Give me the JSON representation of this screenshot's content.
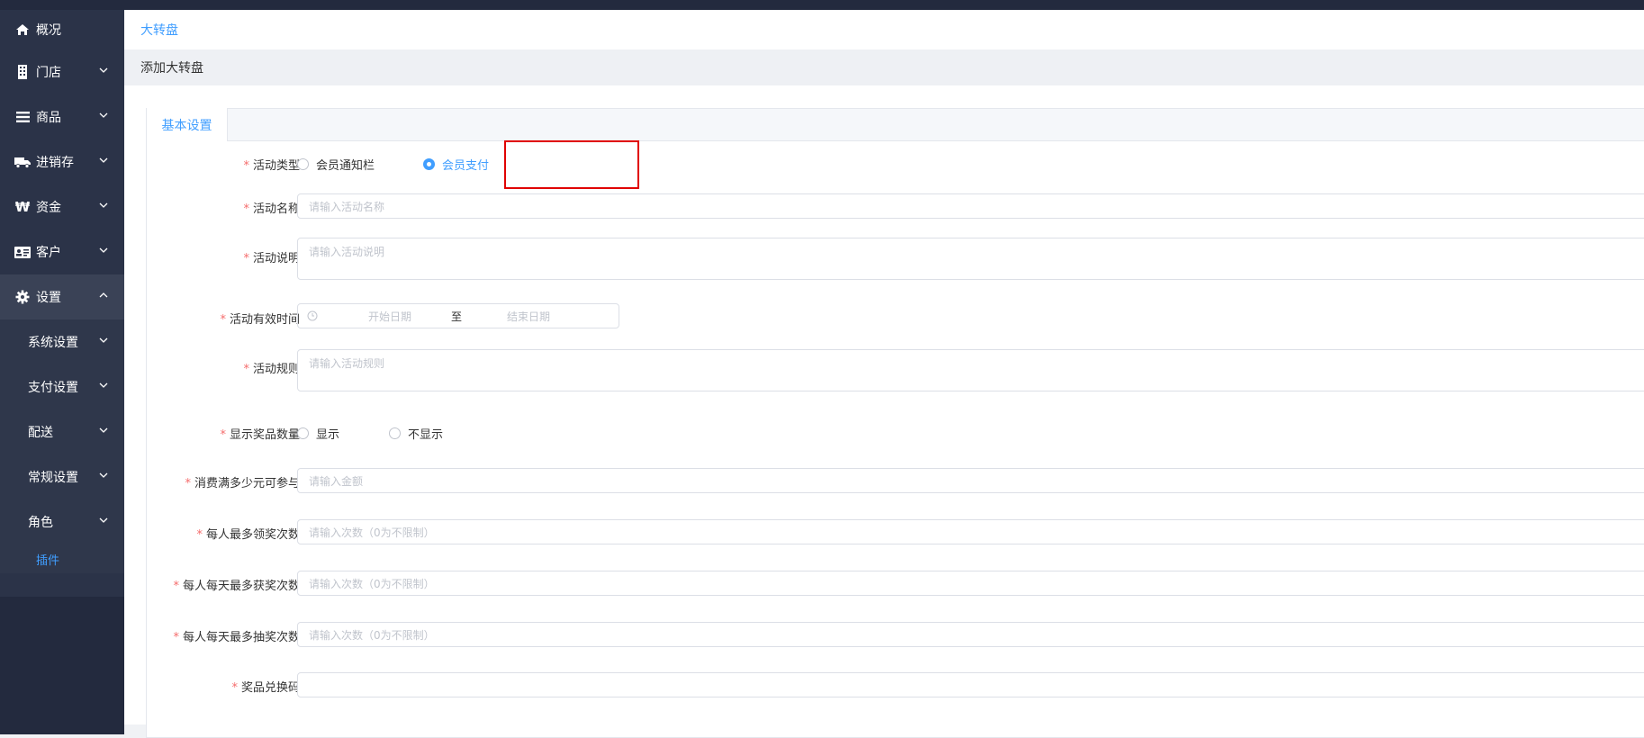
{
  "sidebar": {
    "items": [
      {
        "label": "概况",
        "icon": "home-icon"
      },
      {
        "label": "门店",
        "icon": "building-icon"
      },
      {
        "label": "商品",
        "icon": "list-icon"
      },
      {
        "label": "进销存",
        "icon": "truck-icon"
      },
      {
        "label": "资金",
        "icon": "won-icon"
      },
      {
        "label": "客户",
        "icon": "id-card-icon"
      },
      {
        "label": "设置",
        "icon": "gear-icon"
      }
    ],
    "sub_items": [
      {
        "label": "系统设置"
      },
      {
        "label": "支付设置"
      },
      {
        "label": "配送"
      },
      {
        "label": "常规设置"
      },
      {
        "label": "角色"
      }
    ],
    "leaf": "插件"
  },
  "breadcrumb": "大转盘",
  "subtitle": "添加大转盘",
  "tab": "基本设置",
  "form": {
    "activity_type": {
      "label": "活动类型",
      "options": [
        "会员通知栏",
        "会员支付"
      ],
      "selected": "会员支付"
    },
    "activity_name": {
      "label": "活动名称",
      "placeholder": "请输入活动名称"
    },
    "activity_desc": {
      "label": "活动说明",
      "placeholder": "请输入活动说明"
    },
    "valid_time": {
      "label": "活动有效时间",
      "start_placeholder": "开始日期",
      "separator": "至",
      "end_placeholder": "结束日期"
    },
    "activity_rules": {
      "label": "活动规则",
      "placeholder": "请输入活动规则"
    },
    "show_prize_count": {
      "label": "显示奖品数量",
      "options": [
        "显示",
        "不显示"
      ]
    },
    "min_spend": {
      "label": "消费满多少元可参与",
      "placeholder": "请输入金额"
    },
    "max_claims": {
      "label": "每人最多领奖次数",
      "placeholder": "请输入次数（0为不限制）"
    },
    "max_daily_wins": {
      "label": "每人每天最多获奖次数",
      "placeholder": "请输入次数（0为不限制）"
    },
    "max_daily_draws": {
      "label": "每人每天最多抽奖次数",
      "placeholder": "请输入次数（0为不限制）"
    },
    "redeem_code": {
      "label": "奖品兑换码",
      "placeholder": ""
    }
  },
  "colors": {
    "accent": "#409eff",
    "sidebar": "#2b3348",
    "required": "#f56c6c",
    "highlight": "#e00000"
  }
}
